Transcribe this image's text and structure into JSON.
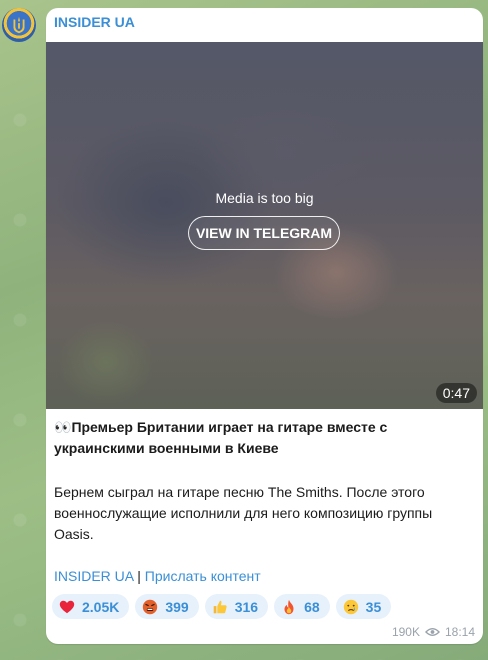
{
  "channel": {
    "name": "INSIDER UA",
    "avatar_icon": "ukraine-trident-icon"
  },
  "media": {
    "message": "Media is too big",
    "button_label": "VIEW IN TELEGRAM",
    "duration": "0:47"
  },
  "post": {
    "title_emoji": "👀",
    "title": "Премьер Британии играет на гитаре вместе с украинскими военными в Киеве",
    "body": "Бернем сыграл на гитаре песню The Smiths. После этого военнослужащие исполнили для него композицию группы Oasis.",
    "link_channel": "INSIDER UA",
    "separator": " | ",
    "link_submit": "Прислать контент"
  },
  "reactions": [
    {
      "icon": "heart-icon",
      "count": "2.05K"
    },
    {
      "icon": "angry-face-icon",
      "count": "399"
    },
    {
      "icon": "thumbs-up-icon",
      "count": "316"
    },
    {
      "icon": "fire-icon",
      "count": "68"
    },
    {
      "icon": "crying-face-icon",
      "count": "35"
    }
  ],
  "footer": {
    "views": "190K",
    "views_icon": "eye-icon",
    "time": "18:14"
  },
  "colors": {
    "accent": "#3a8fd6",
    "reaction_bg": "#e7f1fb",
    "meta": "#9aa3ab"
  }
}
